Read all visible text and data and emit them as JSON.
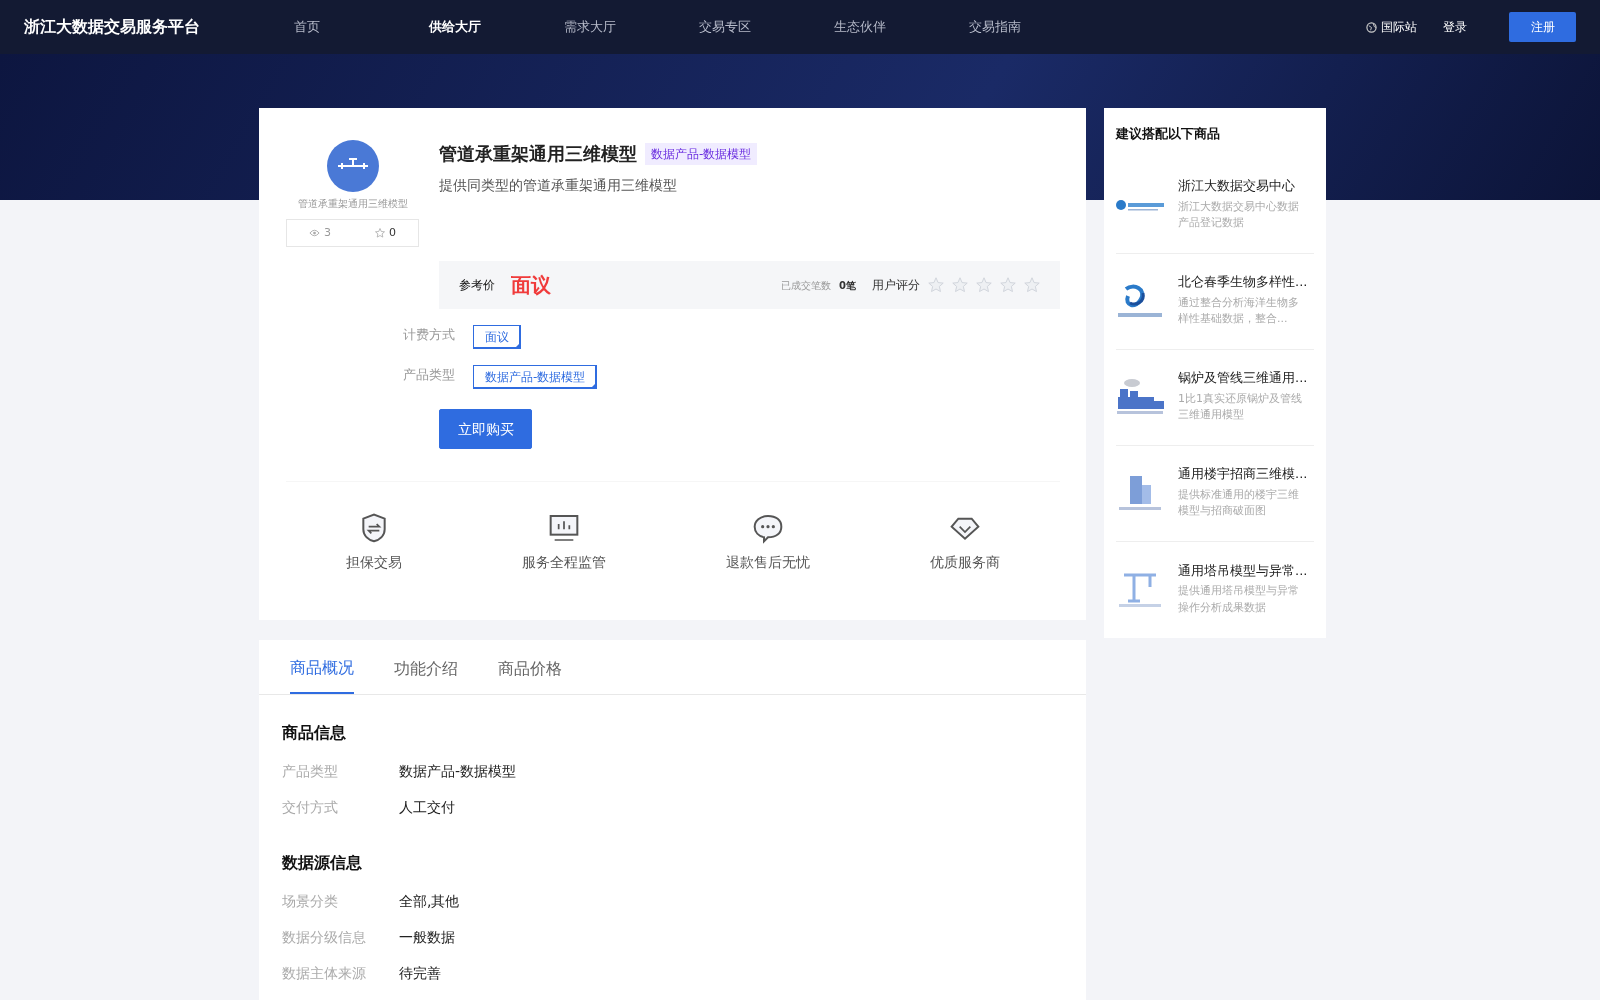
{
  "header": {
    "logo": "浙江大数据交易服务平台",
    "nav": [
      {
        "label": "首页",
        "selected": false
      },
      {
        "label": "供给大厅",
        "selected": true
      },
      {
        "label": "需求大厅",
        "selected": false
      },
      {
        "label": "交易专区",
        "selected": false
      },
      {
        "label": "生态伙伴",
        "selected": false
      },
      {
        "label": "交易指南",
        "selected": false
      }
    ],
    "site": "国际站",
    "login": "登录",
    "register": "注册"
  },
  "product": {
    "avatar_caption": "管道承重架通用三维模型",
    "views": "3",
    "favorites": "0",
    "title": "管道承重架通用三维模型",
    "tag": "数据产品-数据模型",
    "subtitle": "提供同类型的管道承重架通用三维模型",
    "price_label": "参考价",
    "price": "面议",
    "deals_label": "已成交笔数",
    "deals": "0笔",
    "rating_label": "用户评分",
    "stars": 0,
    "options": [
      {
        "label": "计费方式",
        "value": "面议",
        "selected": true
      },
      {
        "label": "产品类型",
        "value": "数据产品-数据模型",
        "selected": true
      }
    ],
    "buy": "立即购买",
    "features": [
      {
        "kind": "shield",
        "label": "担保交易"
      },
      {
        "kind": "monitor",
        "label": "服务全程监管"
      },
      {
        "kind": "chat",
        "label": "退款售后无忧"
      },
      {
        "kind": "diamond",
        "label": "优质服务商"
      }
    ]
  },
  "tabs": [
    {
      "label": "商品概况",
      "selected": true
    },
    {
      "label": "功能介绍",
      "selected": false
    },
    {
      "label": "商品价格",
      "selected": false
    }
  ],
  "sections": [
    {
      "title": "商品信息",
      "rows": [
        {
          "label": "产品类型",
          "value": "数据产品-数据模型"
        },
        {
          "label": "交付方式",
          "value": "人工交付"
        }
      ]
    },
    {
      "title": "数据源信息",
      "rows": [
        {
          "label": "场景分类",
          "value": "全部,其他"
        },
        {
          "label": "数据分级信息",
          "value": "一般数据"
        },
        {
          "label": "数据主体来源",
          "value": "待完善"
        }
      ]
    }
  ],
  "suggest": {
    "title": "建议搭配以下商品",
    "items": [
      {
        "kind": "logo",
        "title": "浙江大数据交易中心",
        "desc": "浙江大数据交易中心数据产品登记数据"
      },
      {
        "kind": "wave",
        "title": "北仑春季生物多样性...",
        "desc": "通过整合分析海洋生物多样性基础数据，整合..."
      },
      {
        "kind": "factory",
        "title": "锅炉及管线三维通用...",
        "desc": "1比1真实还原锅炉及管线三维通用模型"
      },
      {
        "kind": "building",
        "title": "通用楼宇招商三维模...",
        "desc": "提供标准通用的楼宇三维模型与招商破面图"
      },
      {
        "kind": "crane",
        "title": "通用塔吊模型与异常...",
        "desc": "提供通用塔吊模型与异常操作分析成果数据"
      }
    ]
  }
}
